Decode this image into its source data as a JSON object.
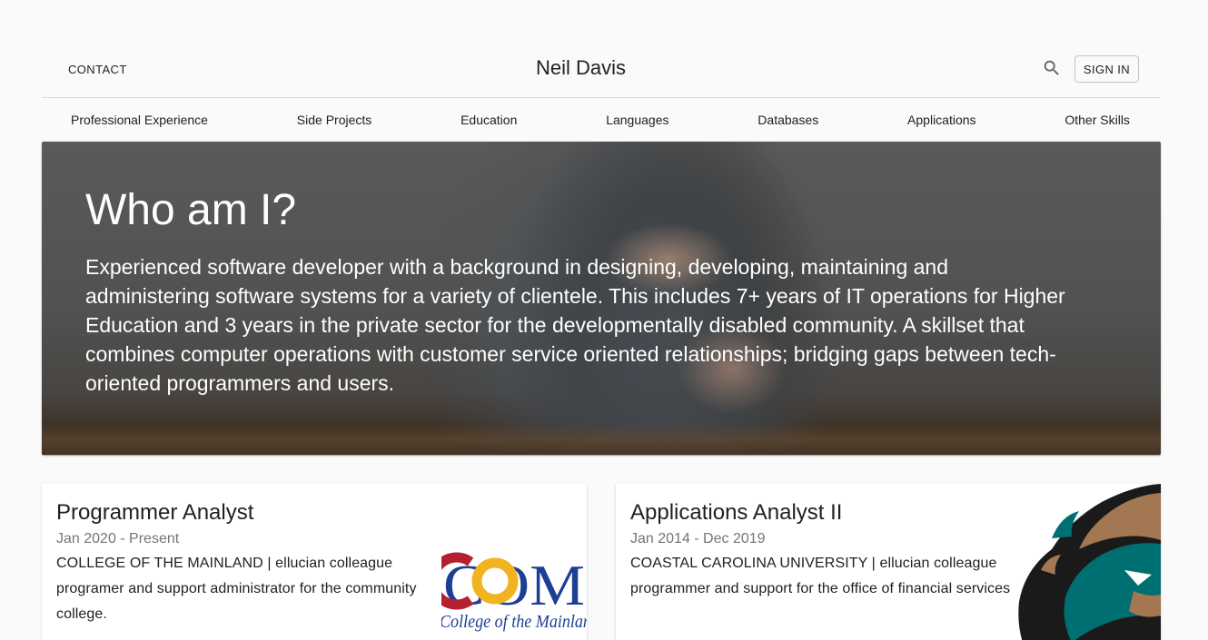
{
  "header": {
    "contact_label": "CONTACT",
    "site_title": "Neil Davis",
    "signin_label": "SIGN IN",
    "search_icon": "search-icon"
  },
  "nav": {
    "items": [
      {
        "label": "Professional Experience"
      },
      {
        "label": "Side Projects"
      },
      {
        "label": "Education"
      },
      {
        "label": "Languages"
      },
      {
        "label": "Databases"
      },
      {
        "label": "Applications"
      },
      {
        "label": "Other Skills"
      }
    ]
  },
  "hero": {
    "title": "Who am I?",
    "text": "Experienced software developer with a background in designing, developing, maintaining and administering software systems for a variety of clientele. This includes 7+ years of IT operations for Higher Education and 3 years in the private sector for the developmentally disabled community. A skillset that combines computer operations with customer service oriented relationships; bridging gaps between tech-oriented programmers and users."
  },
  "cards": [
    {
      "title": "Programmer Analyst",
      "date": "Jan 2020 - Present",
      "description": "COLLEGE OF THE MAINLAND | ellucian colleague programer and support administrator for the community college.",
      "logo_letters": "COM",
      "logo_caption": "College of the Mainland"
    },
    {
      "title": "Applications Analyst II",
      "date": "Jan 2014 - Dec 2019",
      "description": "COASTAL CAROLINA UNIVERSITY | ellucian colleague programmer and support for the office of financial services",
      "logo_icon": "chanticleer-mascot-icon"
    }
  ],
  "colors": {
    "background": "#fafafa",
    "text": "#212121",
    "muted": "#757575",
    "com_red": "#b5202e",
    "com_gold": "#f2b321",
    "com_blue": "#1c3f94",
    "ccu_teal": "#006f71",
    "ccu_bronze": "#a27752"
  }
}
